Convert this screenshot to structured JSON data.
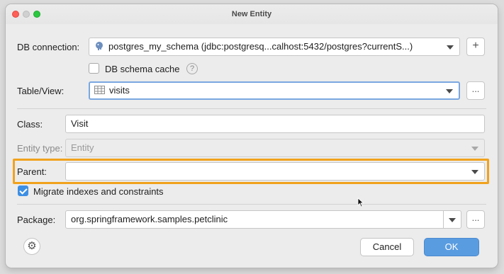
{
  "window": {
    "title": "New Entity"
  },
  "db_connection": {
    "label": "DB connection:",
    "value": "postgres_my_schema (jdbc:postgresq...calhost:5432/postgres?currentS...)",
    "icon": "postgresql-elephant-icon",
    "add_button": "+"
  },
  "db_schema_cache": {
    "label": "DB schema cache",
    "checked": false,
    "help": "?"
  },
  "table_view": {
    "label": "Table/View:",
    "value": "visits",
    "icon": "table-icon",
    "browse_button": "..."
  },
  "class_field": {
    "label": "Class:",
    "value": "Visit"
  },
  "entity_type": {
    "label": "Entity type:",
    "value": "Entity"
  },
  "parent": {
    "label": "Parent:",
    "value": ""
  },
  "migrate": {
    "label": "Migrate indexes and constraints",
    "checked": true
  },
  "package": {
    "label": "Package:",
    "value": "org.springframework.samples.petclinic",
    "browse_button": "..."
  },
  "buttons": {
    "cancel": "Cancel",
    "ok": "OK"
  },
  "colors": {
    "highlight": "#f1a21d",
    "primary": "#5a9ce0",
    "focus": "#7aa7e0"
  }
}
